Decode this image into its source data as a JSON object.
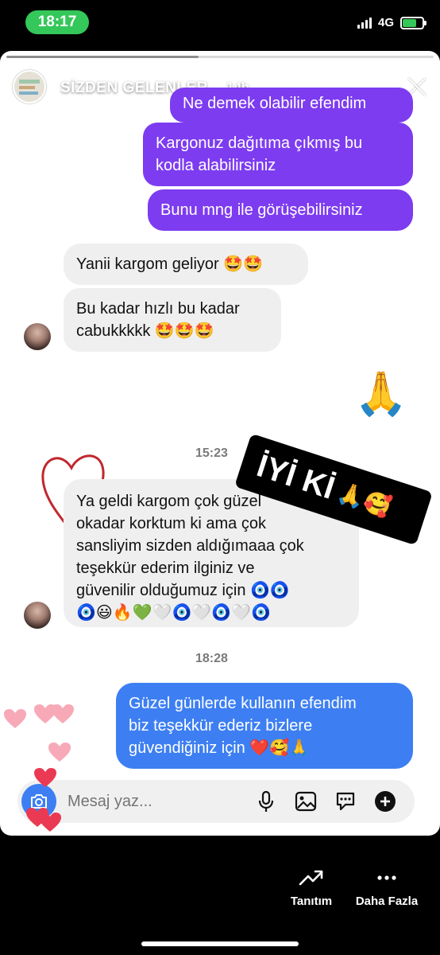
{
  "status_bar": {
    "time": "18:17",
    "network": "4G"
  },
  "story": {
    "title": "SİZDEN GELENLER",
    "age": "14h",
    "progress_fraction": 0.45
  },
  "messages": {
    "m1": "Ne demek olabilir efendim",
    "m2_line1": "Kargonuz dağıtıma çıkmış bu",
    "m2_line2": "kodla alabilirsiniz",
    "m3": "Bunu mng ile görüşebilirsiniz",
    "m4": "Yanii kargom geliyor 🤩🤩",
    "m5_line1": "Bu kadar hızlı bu kadar",
    "m5_line2": "cabukkkkk 🤩🤩🤩",
    "pray": "🙏",
    "stamp1": "15:23",
    "m6_line1": "Ya geldi kargom çok güzel",
    "m6_line2": "okadar korktum ki ama çok",
    "m6_line3": "sansliyim sizden aldığımaaa çok",
    "m6_line4": "teşekkür ederim ilginiz ve",
    "m6_line5": "güvenilir olduğumuz için 🧿🧿",
    "m6_line6": "🧿😃🔥💚🤍🧿🤍🧿🤍🧿",
    "stamp2": "18:28",
    "m7_line1": "Güzel günlerde kullanın efendim",
    "m7_line2": "biz teşekkür ederiz bizlere",
    "m7_line3": "güvendiğiniz için ❤️🥰🙏"
  },
  "sticker": {
    "text": "İYİ Kİ",
    "emojis": "🙏🥰"
  },
  "composer": {
    "placeholder": "Mesaj yaz..."
  },
  "actions": {
    "promote": "Tanıtım",
    "more": "Daha Fazla"
  },
  "colors": {
    "outgoing": "#7d3cf0",
    "latest_outgoing": "#3d7ff2",
    "incoming": "#efefef",
    "time_pill": "#34c759"
  },
  "icons": [
    "camera-icon",
    "microphone-icon",
    "gallery-icon",
    "sticker-icon",
    "plus-icon",
    "trend-icon",
    "more-icon",
    "close-icon"
  ]
}
